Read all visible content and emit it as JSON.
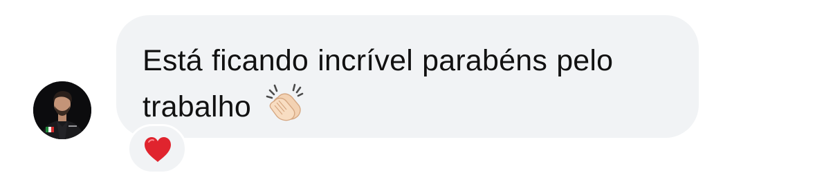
{
  "comment": {
    "text_part1": "Está ficando incrível parabéns pelo",
    "text_part2": "trabalho",
    "text_emoji": "clapping-hands",
    "avatar_icon": "user-avatar",
    "bubble_color": "#f1f3f5",
    "text_color": "#111111"
  },
  "reaction": {
    "icon": "red-heart",
    "color": "#e0242e"
  }
}
